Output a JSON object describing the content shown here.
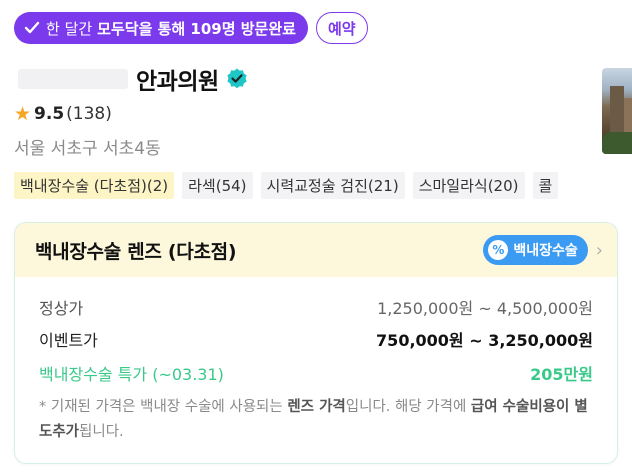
{
  "visit_badge": {
    "prefix": "한 달간",
    "highlight": "모두닥을 통해 109명 방문완료"
  },
  "reserve_label": "예약",
  "clinic": {
    "name": "안과의원",
    "rating": "9.5",
    "review_count": "(138)",
    "address": "서울 서초구 서초4동"
  },
  "tags": [
    "백내장수술 (다초점)(2)",
    "라섹(54)",
    "시력교정술 검진(21)",
    "스마일라식(20)",
    "콜"
  ],
  "card": {
    "title": "백내장수술 렌즈 (다초점)",
    "category_label": "백내장수술",
    "rows": [
      {
        "label": "정상가",
        "value": "1,250,000원 ~ 4,500,000원"
      },
      {
        "label": "이벤트가",
        "value": "750,000원 ~ 3,250,000원"
      },
      {
        "label": "백내장수술 특가 (~03.31)",
        "value": "205만원"
      }
    ],
    "note": {
      "t1": "* 기재된 가격은 백내장 수술에 사용되는 ",
      "b1": "렌즈 가격",
      "t2": "입니다. 해당 가격에 ",
      "b2": "급여 수술비용이 별도추가",
      "t3": "됩니다."
    }
  },
  "colors": {
    "brand_purple": "#7c3aed",
    "highlight_green": "#3bc98a",
    "pill_blue": "#3b9af2",
    "card_header_bg": "#fdf8dc"
  }
}
